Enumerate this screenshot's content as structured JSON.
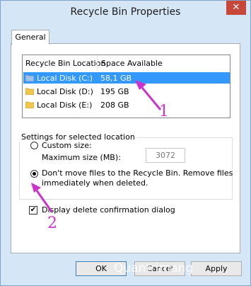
{
  "window": {
    "title": "Recycle Bin Properties",
    "close_label": "✕"
  },
  "tabs": [
    {
      "label": "General"
    }
  ],
  "locations": {
    "headers": [
      "Recycle Bin Location",
      "Space Available"
    ],
    "rows": [
      {
        "location": "Local Disk (C:)",
        "space": "58,1 GB",
        "selected": true
      },
      {
        "location": "Local Disk (D:)",
        "space": "195 GB",
        "selected": false
      },
      {
        "location": "Local Disk (E:)",
        "space": "208 GB",
        "selected": false
      }
    ]
  },
  "settings": {
    "group_label": "Settings for selected location",
    "custom_size_label": "Custom size:",
    "max_size_label": "Maximum size (MB):",
    "max_size_value": "3072",
    "dont_move_label_line1": "Don't move files to the Recycle Bin. Remove files",
    "dont_move_label_line2": "immediately when deleted.",
    "selected_option": "dont_move",
    "confirm_label": "Display delete confirmation dialog",
    "confirm_checked": true,
    "confirm_check_glyph": "✔"
  },
  "buttons": {
    "ok": "OK",
    "cancel": "Cancel",
    "apply": "Apply"
  },
  "annotations": {
    "marker_1": "1",
    "marker_2": "2",
    "color": "#cc33cc"
  },
  "watermark": "Quantrimang"
}
